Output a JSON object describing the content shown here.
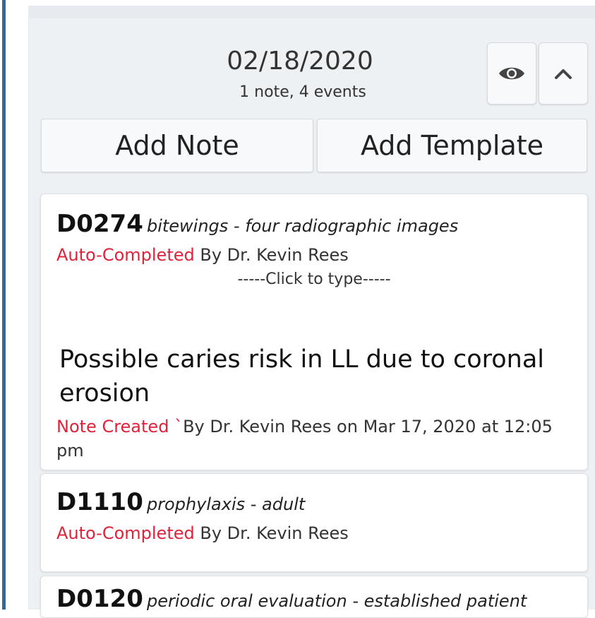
{
  "day": {
    "date": "02/18/2020",
    "summary": "1 note,  4 events"
  },
  "buttons": {
    "add_note": "Add Note",
    "add_template": "Add Template"
  },
  "icons": {
    "view": "eye-icon",
    "collapse": "chevron-up-icon"
  },
  "colors": {
    "accent": "#2c6aa2",
    "status_red": "#e0233b"
  },
  "events": [
    {
      "code": "D0274",
      "description": "bitewings - four radiographic images",
      "status": "Auto-Completed",
      "by": "By Dr. Kevin Rees",
      "placeholder": "-----Click to type-----",
      "note": "Possible caries risk in LL due to coronal erosion",
      "note_status": "Note Created",
      "note_tick": "`",
      "note_meta": "By Dr. Kevin Rees on Mar 17, 2020 at 12:05 pm"
    },
    {
      "code": "D1110",
      "description": "prophylaxis - adult",
      "status": "Auto-Completed",
      "by": "By Dr. Kevin Rees"
    },
    {
      "code": "D0120",
      "description": "periodic oral evaluation - established patient"
    }
  ]
}
